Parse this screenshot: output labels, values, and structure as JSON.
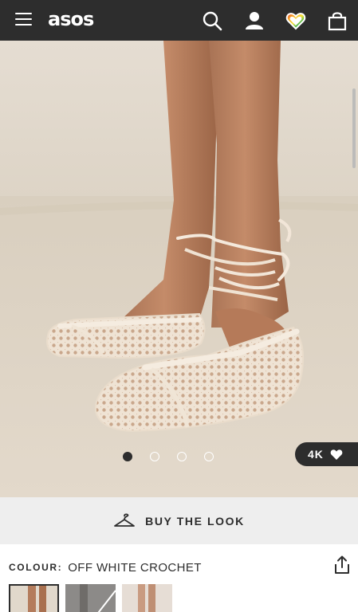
{
  "header": {
    "logo": "asos",
    "icons": [
      "menu-icon",
      "search-icon",
      "account-icon",
      "saved-items-icon",
      "bag-icon"
    ]
  },
  "gallery": {
    "dots_count": 4,
    "active_dot": 0,
    "saves_count": "4K"
  },
  "buy_the_look": {
    "label": "BUY THE LOOK"
  },
  "colour": {
    "label": "COLOUR:",
    "value": "OFF WHITE CROCHET"
  },
  "thumbnails": {
    "count": 3,
    "selected": 0
  },
  "colors": {
    "header_bg": "#2d2d2d",
    "buy_look_bg": "#eeeeee",
    "text": "#2d2d2d"
  }
}
